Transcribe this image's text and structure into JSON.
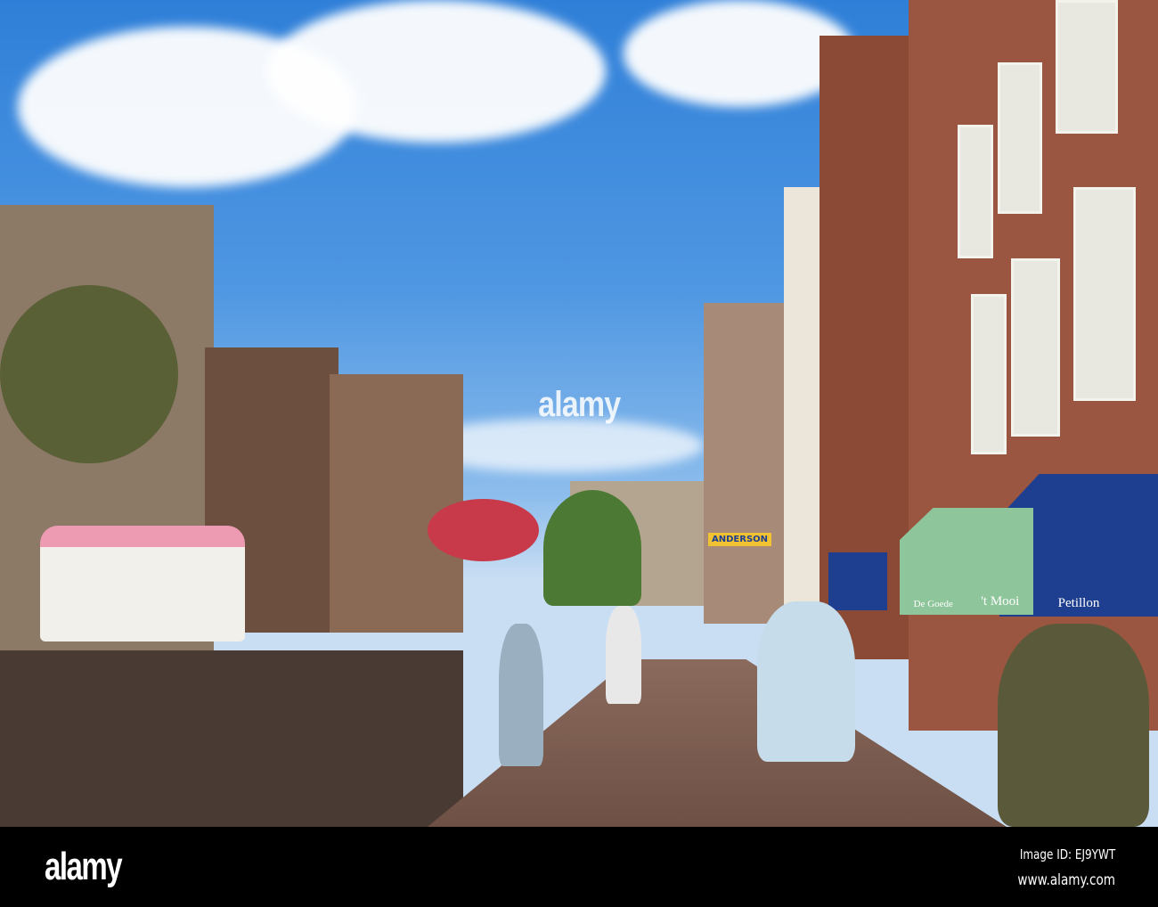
{
  "photo": {
    "subject": "Utrecht canal street with cyclists and gabled buildings",
    "shop_signs": {
      "awning_right": "Petillon",
      "awning_green": "'t Mooi",
      "awning_green_small": "De Goede",
      "sign_yellow": "ANDERSON"
    }
  },
  "watermark": "alamy",
  "footer": {
    "logo": "alamy",
    "image_id": "Image ID: EJ9YWT",
    "url": "www.alamy.com"
  },
  "colors": {
    "sky": "#4f97e2",
    "brick": "#8b4a35",
    "awning_blue": "#1e3f8f",
    "awning_green": "#8fc59a"
  }
}
